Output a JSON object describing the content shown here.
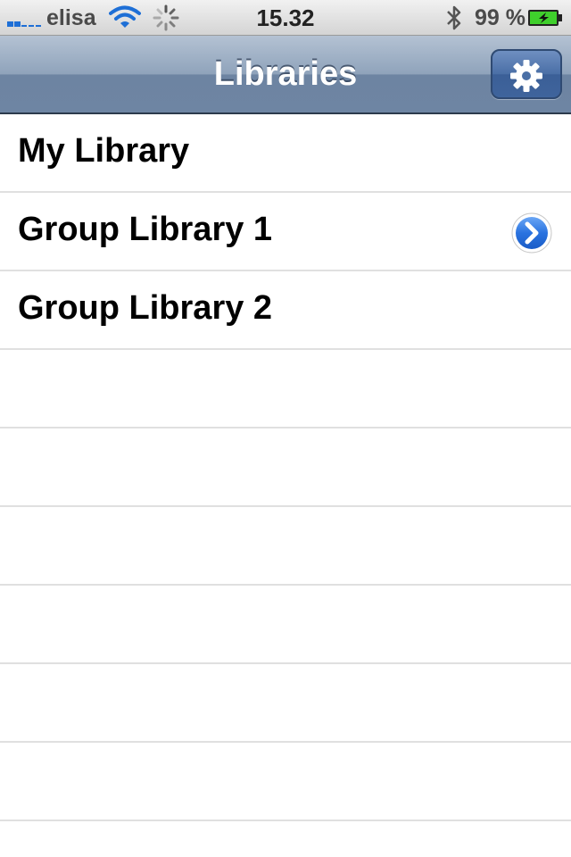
{
  "status_bar": {
    "carrier": "elisa",
    "time": "15.32",
    "battery_percent": "99 %",
    "icons": [
      "signal-icon",
      "wifi-icon",
      "activity-spinner-icon",
      "bluetooth-icon",
      "battery-charging-icon"
    ]
  },
  "nav_bar": {
    "title": "Libraries",
    "settings_icon": "gear-icon"
  },
  "libraries": {
    "items": [
      {
        "label": "My Library"
      },
      {
        "label": "Group Library 1",
        "accessory": "detail-disclosure-icon"
      },
      {
        "label": "Group Library 2"
      }
    ]
  }
}
